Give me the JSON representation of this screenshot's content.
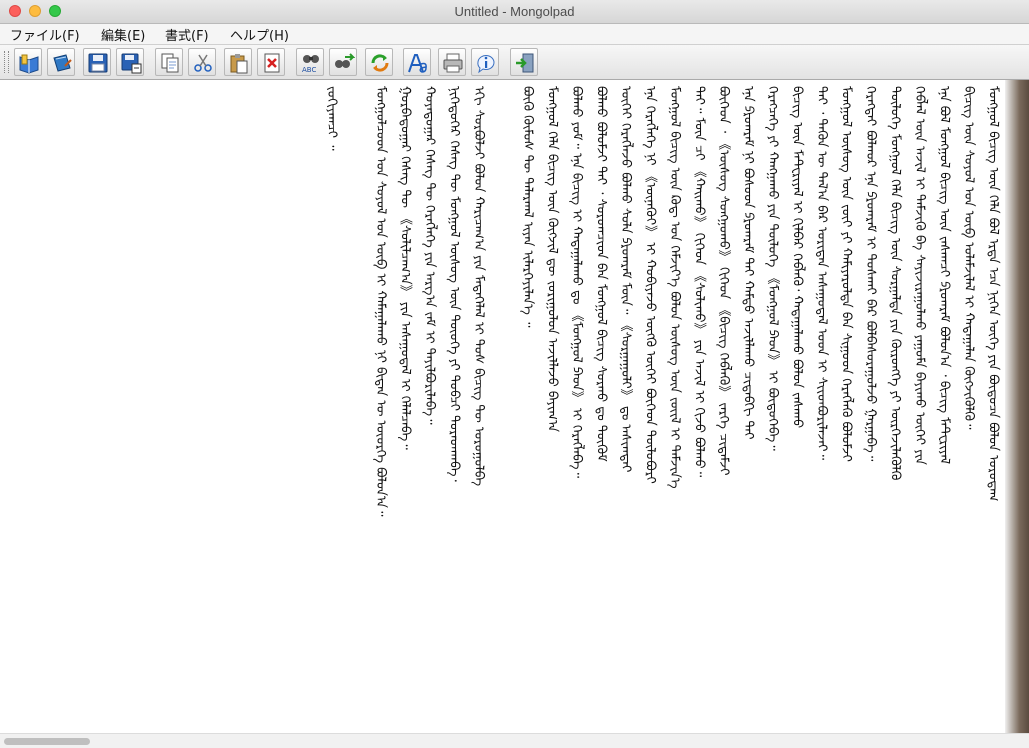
{
  "window": {
    "title": "Untitled - Mongolpad"
  },
  "menu": [
    {
      "label": "ファイル(F)"
    },
    {
      "label": "編集(E)"
    },
    {
      "label": "書式(F)"
    },
    {
      "label": "ヘルプ(H)"
    }
  ],
  "toolbar": {
    "buttons": [
      {
        "name": "open-book-button",
        "icon": "open-book-icon"
      },
      {
        "name": "edit-book-button",
        "icon": "edit-book-icon"
      },
      {
        "name": "save-button",
        "icon": "floppy-icon"
      },
      {
        "name": "save-as-button",
        "icon": "floppy-save-as-icon"
      },
      {
        "name": "copy-button",
        "icon": "copy-icon"
      },
      {
        "name": "cut-button",
        "icon": "scissors-icon"
      },
      {
        "name": "paste-button",
        "icon": "paste-icon"
      },
      {
        "name": "delete-button",
        "icon": "delete-icon"
      },
      {
        "name": "spellcheck-button",
        "icon": "binoculars-abc-icon"
      },
      {
        "name": "find-replace-button",
        "icon": "binoculars-arrow-icon"
      },
      {
        "name": "refresh-button",
        "icon": "refresh-icon"
      },
      {
        "name": "font-button",
        "icon": "font-icon"
      },
      {
        "name": "print-button",
        "icon": "printer-icon"
      },
      {
        "name": "about-button",
        "icon": "info-icon"
      },
      {
        "name": "exit-button",
        "icon": "exit-door-icon"
      }
    ],
    "labels": {
      "spellcheck": "ABC"
    }
  },
  "document": {
    "columns": [
      "ᠮᠣᠩᠭᠣᠯ ᠪᠢᠴᠢᠭ ᠦᠨ ᠬᠡᠯᠡ ᠪᠣᠯ ᠡᠷᠲᠡ ᠡᠴᠡ ᠨᠢᠭᠡᠨ ᠦᠭᠡ ᠶᠢᠨ ᠪᠦᠲᠦᠴᠡ ᠪᠣᠯᠤᠨ ᠣᠷᠣᠳᠠᠭ",
      "ᠪᠢᠴᠢᠭ ᠦᠨ ᠰᠣᠶᠣᠯ ᠤᠨ ᠦᠪ ᠤᠯᠠᠮᠵᠢᠯᠠᠯ ᠢ ᠬᠠᠳᠠᠭᠠᠯᠠᠨ ᠬᠥᠭᠵᠢᠭᠦᠯᠬᠦ᠃",
      "ᠡᠨᠡ ᠪᠣᠯ ᠮᠣᠩᠭᠣᠯ ᠪᠢᠴᠢᠭ ᠦᠨ ᠵᠠᠰᠠᠭᠴᠢ ᠫᠷᠣᠭ᠍ᠷᠠᠮ ᠪᠣᠯᠤᠨ᠎ᠠ ᠂ ᠪᠢᠴᠢᠭ ᠮᠠᠲ᠋ᠧᠷᠢᠶᠠᠯ",
      "ᠬᠡᠪᠯᠡᠯ ᠦᠨ ᠠᠵᠢᠯ ᠢ ᠳᠡᠮᠵᠢᠬᠦ ᠪᠠ ᠰᠠᠶᠢᠵᠢᠷᠠᠭᠤᠯᠬᠤ ᠶᠠᠭᠤᠮᠠ ᠪᠠᠶᠢᠬᠤ ᠦᠭᠡᠢ ᠶᠢᠨ",
      "ᠲᠥᠯᠥᠭᠡ ᠮᠣᠩᠭᠣᠯ ᠬᠡᠯᠡ ᠪᠢᠴᠢᠭ ᠦᠨ ᠰᠤᠷᠭᠠᠯᠲᠠ ᠶᠢᠨ ᠬᠥᠷᠥᠩᠭᠡ ᠶᠢ ᠦᠷᠭᠡᠵᠢᠯᠡᠭᠦᠯᠬᠦ",
      "ᠬᠡᠷᠡᠭᠲᠡᠢ ᠪᠣᠯᠬᠣᠷ ᠡᠨᠡ ᠫᠷᠣᠭ᠍ᠷᠠᠮ ᠢ ᠲᠤᠰᠬᠠᠢ ᠪᠡᠷ ᠪᠣᠯᠪᠠᠰᠤᠷᠠᠭᠤᠯᠵᠤ ᠭᠠᠷᠭᠠᠪᠠ᠃",
      "ᠮᠣᠩᠭᠣᠯ ᠦᠰᠦᠭ ᠦᠨ ᠵᠦᠢ ᠶᠢ ᠬᠠᠮᠢᠶᠠᠷᠤᠯᠲᠠ ᠪᠠᠨ ᠰᠢᠭᠤᠳ ᠬᠡᠷᠡᠭᠯᠡᠬᠦ ᠪᠣᠯᠤᠮᠵᠢ",
      "ᠲᠠᠢ ᠂ ᠲᠡᠭᠦᠨ ᠦ ᠲᠠᠯ᠎ᠠ ᠪᠠᠷ ᠤᠷᠢᠳᠠᠨ ᠠᠰᠠᠭᠤᠳᠠᠯ ᠤᠳ ᠢ ᠰᠢᠢᠳᠪᠦᠷᠢᠯᠡᠵᠡᠢ᠃",
      "ᠪᠢᠴᠢᠭ ᠦᠨ ᠮᠠᠲ᠋ᠧᠷᠢᠶᠠᠯ ᠢ ᠬᠢᠯᠪᠠᠷ ᠬᠡᠪᠯᠡᠬᠦ᠂ ᠬᠠᠳᠠᠭᠠᠯᠠᠬᠤ ᠪᠣᠯᠤᠨ ᠵᠠᠰᠠᠬᠤ",
      "ᠬᠡᠷᠡᠭᠴᠡᠭᠡ ᠶᠢ ᠬᠠᠩᠭᠠᠬᠤ ᠶᠢᠨ ᠲᠥᠯᠥᠭᠡ 《ᠮᠣᠩᠭᠣᠯ ᠫᠠᠳ》 ᠢ ᠪᠦᠲᠦᠭᠡᠪᠡ᠃",
      "ᠡᠨᠡ ᠫᠷᠣᠭ᠍ᠷᠠᠮ ᠨᠢ ᠪᠤᠰᠤᠳ ᠫᠷᠣᠭ᠍ᠷᠠᠮ ᠲᠠᠢ ᠬᠠᠮᠲᠤ ᠠᠵᠢᠯᠯᠠᠬᠤ ᠴᠢᠳᠠᠪᠬᠢ ᠲᠠᠢ",
      "ᠪᠥᠭᠡᠳ ᠂ 《ᠦᠰᠦᠭ ᠰᠣᠩᠭᠣᠬᠤ》 ᠬᠢᠭᠡᠳ 《ᠪᠢᠴᠢᠭ ᠬᠡᠪᠯᠡᠬᠦ》 ᠵᠡᠷᠭᠡ ᠴᠢᠳᠠᠮᠵᠢ",
      "ᠲᠠᠢ᠃ ᠮᠥᠨ ᠴᠢ 《ᠬᠠᠢᠬᠤ》 ᠬᠢᠭᠡᠳ 《ᠰᠣᠯᠢᠬᠤ》 ᠶᠢᠨ ᠠᠵᠢᠯ ᠢ ᠬᠢᠵᠦ ᠪᠣᠯᠬᠤ᠃",
      "ᠮᠣᠩᠭᠣᠯ ᠪᠢᠴᠢᠭ ᠦᠨ ᠺᠣᠳ᠋ ᠤᠨ ᠬᠡᠮᠵᠢᠶ᠎ᠡ ᠪᠣᠯᠤᠨ ᠦᠰᠦᠭ ᠦᠨ ᠵᠦᠢᠯ ᠢ ᠳᠡᠮᠵᠢᠨ᠎ᠡ",
      "ᠡᠨᠡ ᠬᠡᠷᠡᠭᠯᠡᠭᠡ ᠨᠢ 《ᠦᠨᠡᠭᠦᠢ》 ᠢ ᠬᠤᠪᠢᠶᠠᠵᠤ ᠥᠭᠬᠦ ᠦᠭᠡᠢ ᠪᠥᠭᠡᠳ ᠲᠥᠯᠥᠪᠦᠷᠢ",
      "ᠦᠭᠡᠢ ᠬᠡᠷᠡᠭᠯᠡᠵᠦ ᠪᠣᠯᠬᠤ ᠰᠤᠯᠠ ᠫᠷᠣᠭ᠍ᠷᠠᠮ ᠮᠥᠨ᠃ 《ᠰᠤᠷᠭᠠᠭᠤᠯᠢ》 ᠳᠤ ᠠᠰᠢᠭᠲᠠᠢ",
      "ᠪᠣᠯᠬᠤ ᠪᠣᠯᠤᠮᠵᠢ ᠲᠠᠢ ᠂ ᠰᠤᠷᠤᠭᠴᠢᠳ ᠪᠠᠨ ᠮᠣᠩᠭᠣᠯ ᠪᠢᠴᠢᠭ ᠰᠤᠷᠬᠤ ᠳᠤ ᠳᠥᠭᠥᠮ",
      "ᠪᠣᠯᠬᠤ ᠶᠤᠮ᠃ ᠡᠨᠡ ᠪᠢᠴᠢᠭ ᠢ ᠬᠠᠳᠠᠭᠠᠯᠠᠬᠤ ᠳᠤ 《ᠮᠣᠩᠭᠣᠯ ᠫᠠᠳ》 ᠢ ᠬᠡᠷᠡᠭᠯᠡᠪᠡ᠃",
      "ᠮᠣᠩᠭᠣᠯ ᠬᠡᠯᠡ ᠪᠢᠴᠢᠭ ᠦᠨ ᠬᠥᠭᠵᠢᠯ ᠳᠦ ᠵᠣᠷᠢᠭᠤᠯᠤᠨ ᠠᠵᠢᠯᠯᠠᠵᠤ ᠪᠠᠶᠢᠭ᠎ᠠ",
      "ᠪᠥᠬᠦ ᠬᠦᠮᠦᠰ ᠲᠦ ᠲᠠᠯᠠᠷᠬᠠᠯ ᠢᠶᠠᠨ ᠢᠯᠡᠷᠬᠡᠶᠢᠯᠡᠨ᠎ᠡ ᠃",
      "",
      "ᠡᠬᠢ ᠰᠤᠷᠪᠤᠯᠵᠢ ᠪᠣᠯᠤᠨ ᠬᠠᠷᠢᠴᠠᠭ᠎ᠠ ᠶᠢᠨ ᠮᠡᠳᠡᠭᠡᠯᠡᠯ ᠢ ᠲᠤᠰ ᠪᠢᠴᠢᠭ ᠲᠦ ᠣᠷᠣᠭᠤᠯᠪᠠ",
      "ᠨᠢᠭᠡᠳᠦᠭᠡᠷ ᠬᠡᠰᠡᠭ ᠲᠦ ᠮᠣᠩᠭᠣᠯ ᠦᠰᠦᠭ ᠦᠨ ᠲᠦᠦᠬᠡ ᠶᠢ ᠲᠣᠪᠴᠢ ᠳᠤᠷᠠᠳᠬᠠᠪᠠ᠂",
      "ᠬᠣᠶᠠᠳᠤᠭᠠᠷ ᠬᠡᠰᠡᠭ ᠲᠦ ᠬᠡᠷᠡᠭᠯᠡᠭᠡ ᠶᠢᠨ ᠠᠷᠭ᠎ᠠ ᠵᠠᠮ ᠢ ᠲᠠᠶᠢᠯᠪᠤᠷᠢᠯᠠᠪᠠ᠃",
      "ᠭᠤᠷᠪᠠᠳᠤᠭᠠᠷ ᠬᠡᠰᠡᠭ ᠲᠦ 《ᠰᠣᠯᠢᠯᠴᠠᠭ᠎ᠠ》 ᠶᠢᠨ ᠠᠰᠠᠭᠤᠳᠠᠯ ᠢ ᠬᠡᠯᠡᠯᠴᠡᠪᠡ᠃",
      "ᠮᠣᠩᠭᠣᠯᠴᠤᠳ ᠤᠨ ᠰᠤᠶᠤᠯ ᠤᠨ ᠦᠪ ᠢ ᠬᠠᠮᠠᠭᠠᠯᠠᠬᠤ ᠨᠢ ᠪᠢᠳᠡᠨ ᠦ ᠦᠦᠷᠭᠡ ᠪᠣᠯᠤᠨ᠎ᠠ᠃",
      "",
      "ᠵᠣᠬᠢᠶᠠᠭᠴᠢ ᠃"
    ],
    "short_columns": [
      20,
      26,
      27
    ]
  },
  "statusbar": {
    "scroll_position": 0.0
  }
}
